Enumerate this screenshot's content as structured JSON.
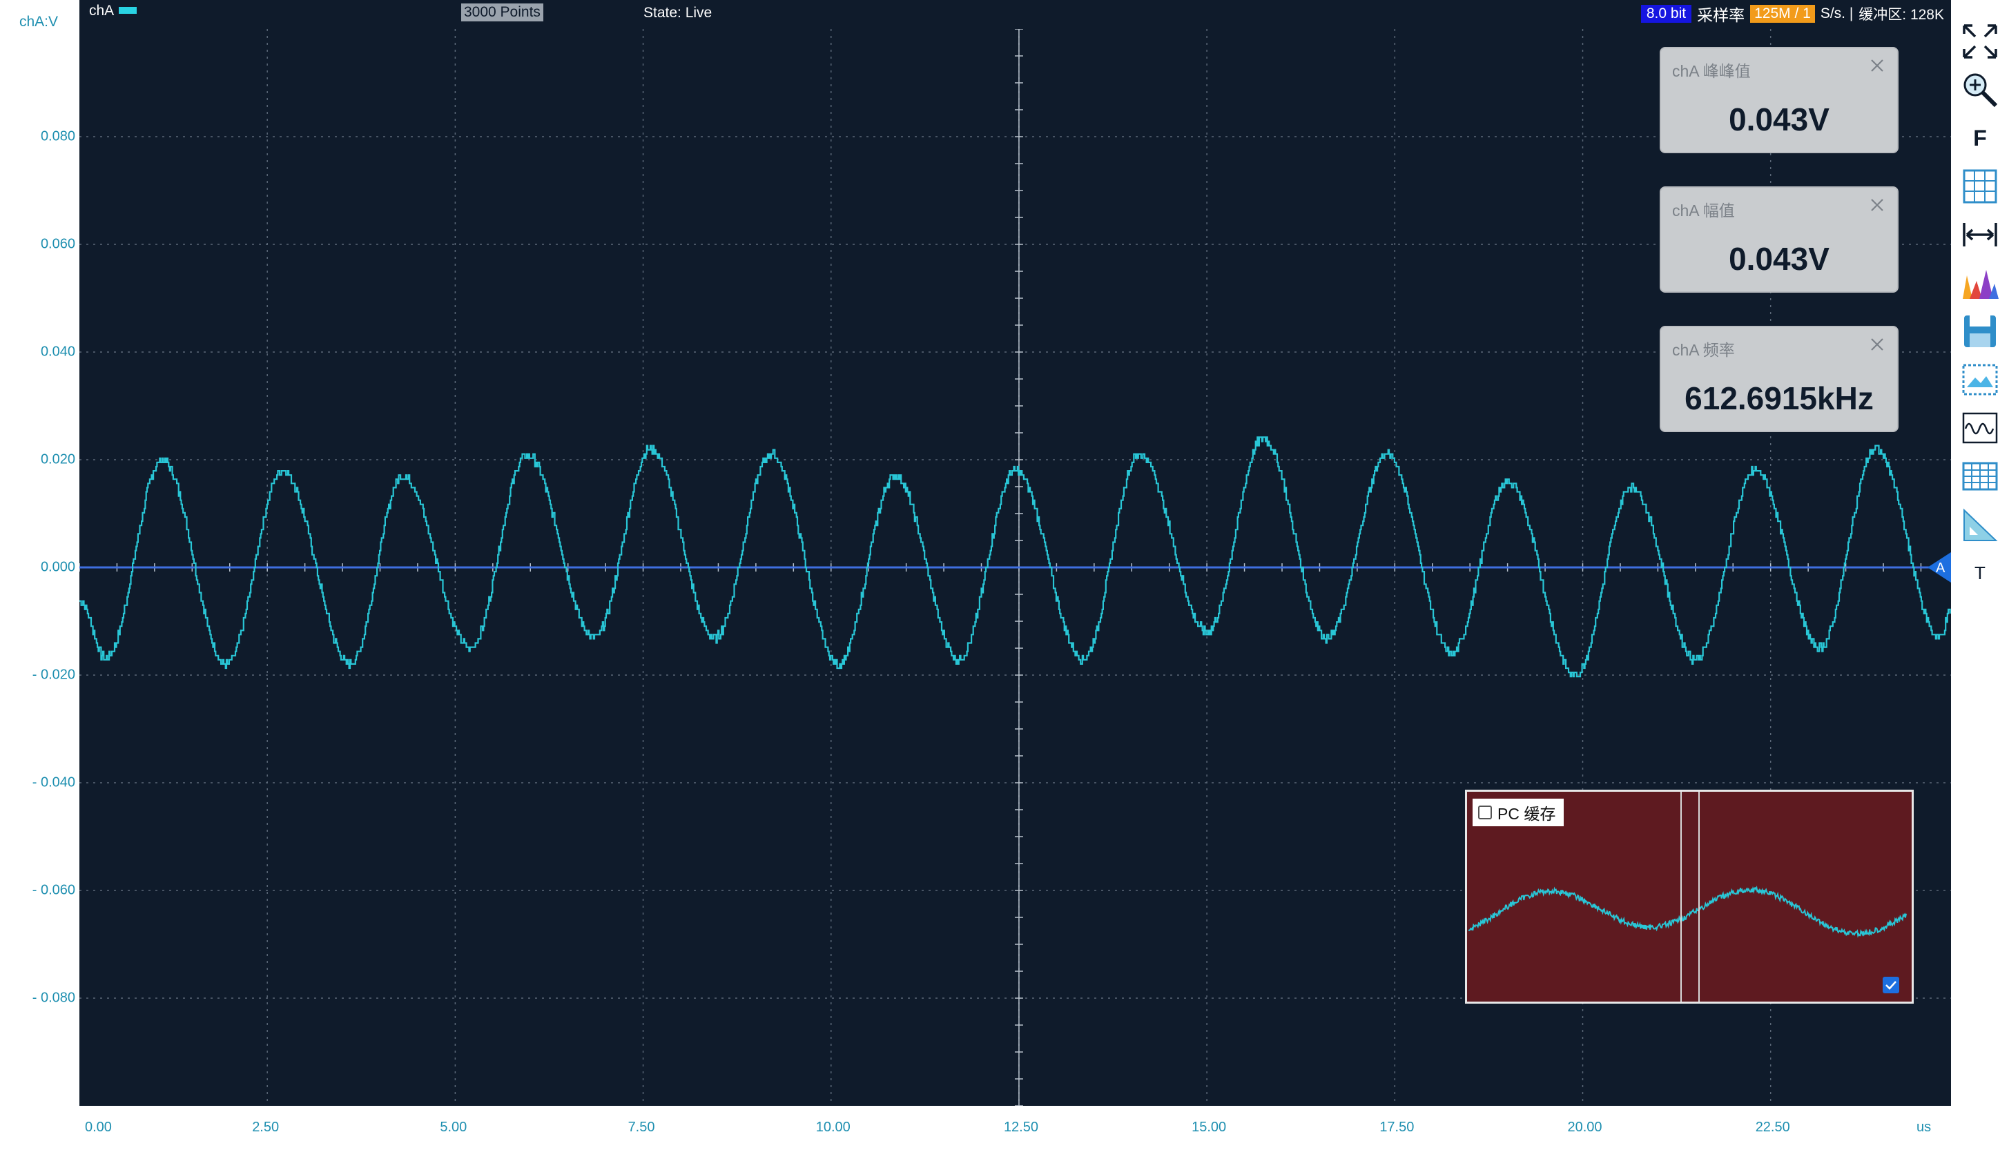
{
  "top_bar": {
    "channel_label": "chA",
    "points": "3000 Points",
    "state": "State: Live",
    "bit_depth": "8.0 bit",
    "sample_rate_label": "采样率",
    "sample_rate_value": "125M / 1",
    "sample_rate_unit": "S/s. |",
    "buffer": "缓冲区: 128K"
  },
  "y_axis": {
    "unit_label": "chA:V",
    "ticks": [
      "0.080",
      "0.060",
      "0.040",
      "0.020",
      "0.000",
      "- 0.020",
      "- 0.040",
      "- 0.060",
      "- 0.080"
    ],
    "tick_values": [
      0.08,
      0.06,
      0.04,
      0.02,
      0.0,
      -0.02,
      -0.04,
      -0.06,
      -0.08
    ],
    "range": [
      -0.1,
      0.1
    ]
  },
  "x_axis": {
    "ticks": [
      "0.00",
      "2.50",
      "5.00",
      "7.50",
      "10.00",
      "12.50",
      "15.00",
      "17.50",
      "20.00",
      "22.50"
    ],
    "tick_values": [
      0,
      2.5,
      5,
      7.5,
      10,
      12.5,
      15,
      17.5,
      20,
      22.5
    ],
    "unit": "us",
    "range": [
      0,
      24.9
    ]
  },
  "measurements": [
    {
      "title": "chA 峰峰值",
      "value": "0.043V"
    },
    {
      "title": "chA 幅值",
      "value": "0.043V"
    },
    {
      "title": "chA 频率",
      "value": "612.6915kHz"
    }
  ],
  "trigger_marker": "A",
  "overview": {
    "pc_cache_label": "PC 缓存",
    "pc_cache_checked": false,
    "bottom_check_checked": true
  },
  "toolbar": {
    "tools": [
      "fullscreen-icon",
      "zoom-in-icon",
      "F",
      "grid-icon",
      "measure-span-icon",
      "spectrum-icon",
      "save-icon",
      "image-icon",
      "waveform-icon",
      "table-icon",
      "ruler-icon",
      "T"
    ]
  },
  "chart_data": {
    "type": "line",
    "xlabel": "us",
    "ylabel": "chA:V",
    "xlim": [
      0,
      24.9
    ],
    "ylim": [
      -0.1,
      0.1
    ],
    "grid": true,
    "series": [
      {
        "color": "#29c6d6",
        "frequency_khz": 612.6915,
        "peaks_x": [
          1.1,
          2.7,
          4.3,
          5.95,
          7.6,
          9.2,
          10.85,
          12.45,
          14.1,
          15.75,
          17.4,
          19.0,
          20.65,
          22.3,
          23.9
        ],
        "peaks_y": [
          0.02,
          0.018,
          0.017,
          0.021,
          0.022,
          0.021,
          0.017,
          0.018,
          0.021,
          0.024,
          0.021,
          0.016,
          0.015,
          0.018,
          0.022
        ],
        "troughs_x": [
          0.35,
          1.95,
          3.6,
          5.2,
          6.85,
          8.45,
          10.1,
          11.7,
          13.35,
          15.0,
          16.6,
          18.25,
          19.9,
          21.5,
          23.15,
          24.75
        ],
        "troughs_y": [
          -0.017,
          -0.018,
          -0.018,
          -0.015,
          -0.013,
          -0.013,
          -0.018,
          -0.017,
          -0.017,
          -0.012,
          -0.013,
          -0.016,
          -0.02,
          -0.017,
          -0.015,
          -0.013
        ]
      }
    ],
    "trigger_level": 0.0
  }
}
